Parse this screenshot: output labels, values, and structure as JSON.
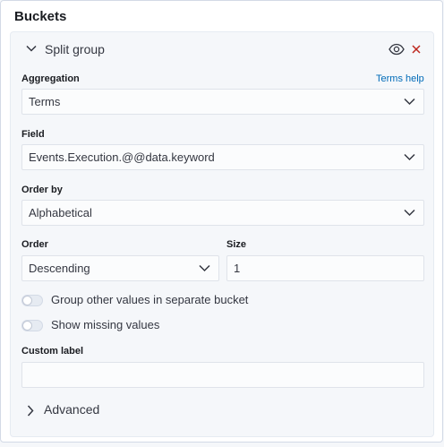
{
  "panel": {
    "title": "Buckets"
  },
  "group": {
    "title": "Split group",
    "toggle_icon": "eye-icon",
    "remove_icon": "close-icon",
    "remove_color": "#bd271e"
  },
  "aggregation": {
    "label": "Aggregation",
    "help": "Terms help",
    "value": "Terms"
  },
  "field": {
    "label": "Field",
    "value": "Events.Execution.@@data.keyword"
  },
  "order_by": {
    "label": "Order by",
    "value": "Alphabetical"
  },
  "order": {
    "label": "Order",
    "value": "Descending"
  },
  "size": {
    "label": "Size",
    "value": "1"
  },
  "toggles": {
    "group_other": {
      "label": "Group other values in separate bucket",
      "on": false
    },
    "show_missing": {
      "label": "Show missing values",
      "on": false
    }
  },
  "custom_label": {
    "label": "Custom label",
    "value": ""
  },
  "advanced": {
    "label": "Advanced"
  },
  "colors": {
    "accent": "#006bb8",
    "danger": "#bd271e",
    "text": "#343741"
  }
}
